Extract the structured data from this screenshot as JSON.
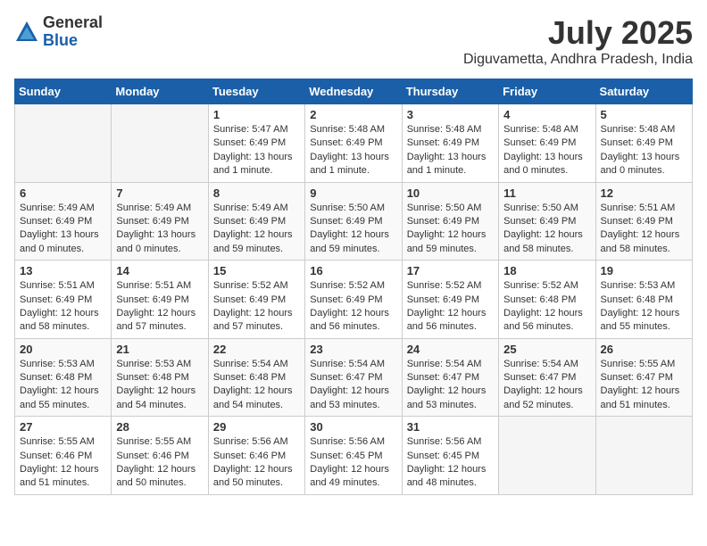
{
  "logo": {
    "general": "General",
    "blue": "Blue"
  },
  "title": "July 2025",
  "location": "Diguvametta, Andhra Pradesh, India",
  "days_of_week": [
    "Sunday",
    "Monday",
    "Tuesday",
    "Wednesday",
    "Thursday",
    "Friday",
    "Saturday"
  ],
  "weeks": [
    [
      {
        "day": "",
        "empty": true
      },
      {
        "day": "",
        "empty": true
      },
      {
        "day": "1",
        "sunrise": "Sunrise: 5:47 AM",
        "sunset": "Sunset: 6:49 PM",
        "daylight": "Daylight: 13 hours and 1 minute."
      },
      {
        "day": "2",
        "sunrise": "Sunrise: 5:48 AM",
        "sunset": "Sunset: 6:49 PM",
        "daylight": "Daylight: 13 hours and 1 minute."
      },
      {
        "day": "3",
        "sunrise": "Sunrise: 5:48 AM",
        "sunset": "Sunset: 6:49 PM",
        "daylight": "Daylight: 13 hours and 1 minute."
      },
      {
        "day": "4",
        "sunrise": "Sunrise: 5:48 AM",
        "sunset": "Sunset: 6:49 PM",
        "daylight": "Daylight: 13 hours and 0 minutes."
      },
      {
        "day": "5",
        "sunrise": "Sunrise: 5:48 AM",
        "sunset": "Sunset: 6:49 PM",
        "daylight": "Daylight: 13 hours and 0 minutes."
      }
    ],
    [
      {
        "day": "6",
        "sunrise": "Sunrise: 5:49 AM",
        "sunset": "Sunset: 6:49 PM",
        "daylight": "Daylight: 13 hours and 0 minutes."
      },
      {
        "day": "7",
        "sunrise": "Sunrise: 5:49 AM",
        "sunset": "Sunset: 6:49 PM",
        "daylight": "Daylight: 13 hours and 0 minutes."
      },
      {
        "day": "8",
        "sunrise": "Sunrise: 5:49 AM",
        "sunset": "Sunset: 6:49 PM",
        "daylight": "Daylight: 12 hours and 59 minutes."
      },
      {
        "day": "9",
        "sunrise": "Sunrise: 5:50 AM",
        "sunset": "Sunset: 6:49 PM",
        "daylight": "Daylight: 12 hours and 59 minutes."
      },
      {
        "day": "10",
        "sunrise": "Sunrise: 5:50 AM",
        "sunset": "Sunset: 6:49 PM",
        "daylight": "Daylight: 12 hours and 59 minutes."
      },
      {
        "day": "11",
        "sunrise": "Sunrise: 5:50 AM",
        "sunset": "Sunset: 6:49 PM",
        "daylight": "Daylight: 12 hours and 58 minutes."
      },
      {
        "day": "12",
        "sunrise": "Sunrise: 5:51 AM",
        "sunset": "Sunset: 6:49 PM",
        "daylight": "Daylight: 12 hours and 58 minutes."
      }
    ],
    [
      {
        "day": "13",
        "sunrise": "Sunrise: 5:51 AM",
        "sunset": "Sunset: 6:49 PM",
        "daylight": "Daylight: 12 hours and 58 minutes."
      },
      {
        "day": "14",
        "sunrise": "Sunrise: 5:51 AM",
        "sunset": "Sunset: 6:49 PM",
        "daylight": "Daylight: 12 hours and 57 minutes."
      },
      {
        "day": "15",
        "sunrise": "Sunrise: 5:52 AM",
        "sunset": "Sunset: 6:49 PM",
        "daylight": "Daylight: 12 hours and 57 minutes."
      },
      {
        "day": "16",
        "sunrise": "Sunrise: 5:52 AM",
        "sunset": "Sunset: 6:49 PM",
        "daylight": "Daylight: 12 hours and 56 minutes."
      },
      {
        "day": "17",
        "sunrise": "Sunrise: 5:52 AM",
        "sunset": "Sunset: 6:49 PM",
        "daylight": "Daylight: 12 hours and 56 minutes."
      },
      {
        "day": "18",
        "sunrise": "Sunrise: 5:52 AM",
        "sunset": "Sunset: 6:48 PM",
        "daylight": "Daylight: 12 hours and 56 minutes."
      },
      {
        "day": "19",
        "sunrise": "Sunrise: 5:53 AM",
        "sunset": "Sunset: 6:48 PM",
        "daylight": "Daylight: 12 hours and 55 minutes."
      }
    ],
    [
      {
        "day": "20",
        "sunrise": "Sunrise: 5:53 AM",
        "sunset": "Sunset: 6:48 PM",
        "daylight": "Daylight: 12 hours and 55 minutes."
      },
      {
        "day": "21",
        "sunrise": "Sunrise: 5:53 AM",
        "sunset": "Sunset: 6:48 PM",
        "daylight": "Daylight: 12 hours and 54 minutes."
      },
      {
        "day": "22",
        "sunrise": "Sunrise: 5:54 AM",
        "sunset": "Sunset: 6:48 PM",
        "daylight": "Daylight: 12 hours and 54 minutes."
      },
      {
        "day": "23",
        "sunrise": "Sunrise: 5:54 AM",
        "sunset": "Sunset: 6:47 PM",
        "daylight": "Daylight: 12 hours and 53 minutes."
      },
      {
        "day": "24",
        "sunrise": "Sunrise: 5:54 AM",
        "sunset": "Sunset: 6:47 PM",
        "daylight": "Daylight: 12 hours and 53 minutes."
      },
      {
        "day": "25",
        "sunrise": "Sunrise: 5:54 AM",
        "sunset": "Sunset: 6:47 PM",
        "daylight": "Daylight: 12 hours and 52 minutes."
      },
      {
        "day": "26",
        "sunrise": "Sunrise: 5:55 AM",
        "sunset": "Sunset: 6:47 PM",
        "daylight": "Daylight: 12 hours and 51 minutes."
      }
    ],
    [
      {
        "day": "27",
        "sunrise": "Sunrise: 5:55 AM",
        "sunset": "Sunset: 6:46 PM",
        "daylight": "Daylight: 12 hours and 51 minutes."
      },
      {
        "day": "28",
        "sunrise": "Sunrise: 5:55 AM",
        "sunset": "Sunset: 6:46 PM",
        "daylight": "Daylight: 12 hours and 50 minutes."
      },
      {
        "day": "29",
        "sunrise": "Sunrise: 5:56 AM",
        "sunset": "Sunset: 6:46 PM",
        "daylight": "Daylight: 12 hours and 50 minutes."
      },
      {
        "day": "30",
        "sunrise": "Sunrise: 5:56 AM",
        "sunset": "Sunset: 6:45 PM",
        "daylight": "Daylight: 12 hours and 49 minutes."
      },
      {
        "day": "31",
        "sunrise": "Sunrise: 5:56 AM",
        "sunset": "Sunset: 6:45 PM",
        "daylight": "Daylight: 12 hours and 48 minutes."
      },
      {
        "day": "",
        "empty": true
      },
      {
        "day": "",
        "empty": true
      }
    ]
  ]
}
